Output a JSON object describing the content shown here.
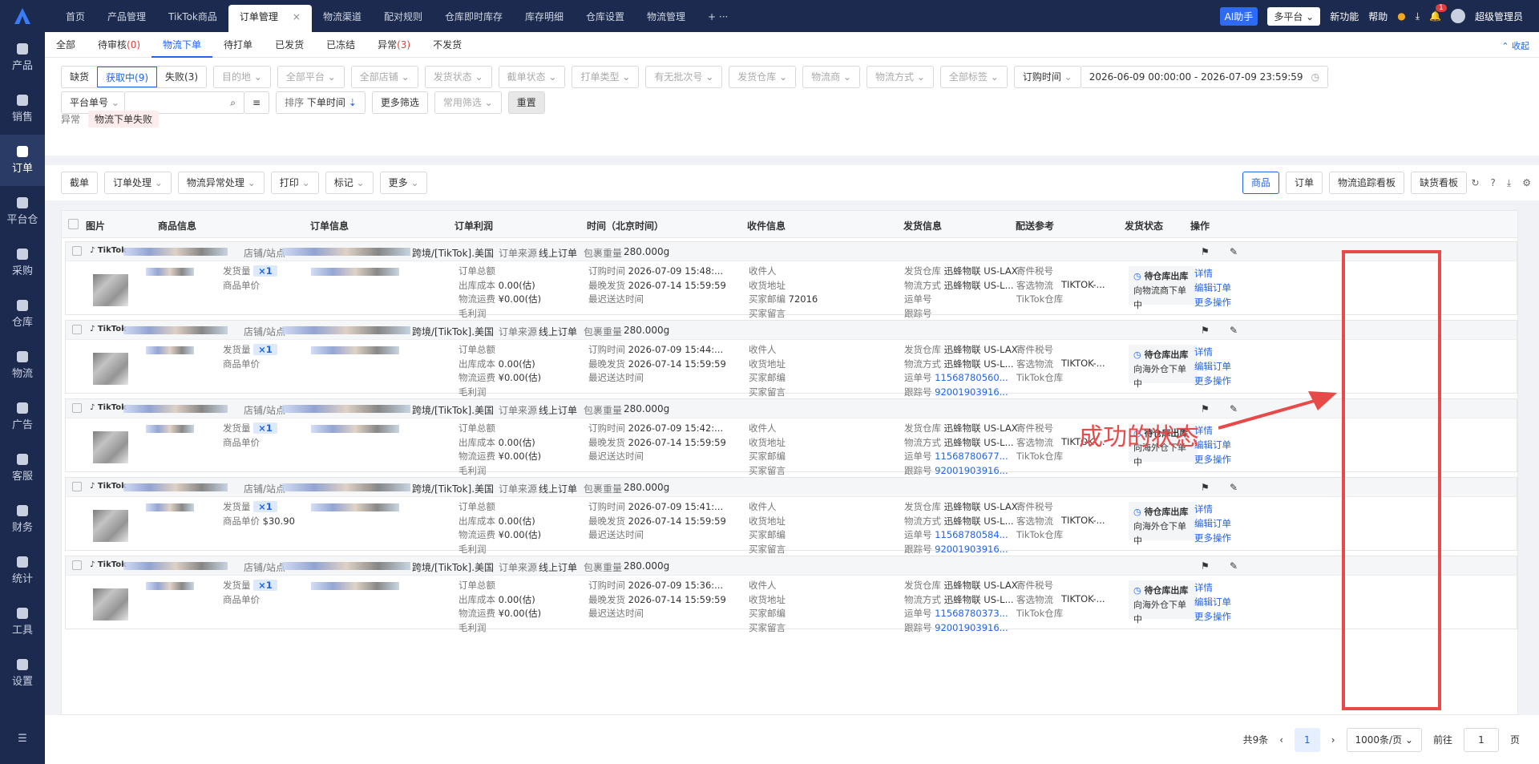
{
  "topbar": {
    "tabs": [
      "首页",
      "产品管理",
      "TikTok商品",
      "订单管理",
      "物流渠道",
      "配对规则",
      "仓库即时库存",
      "库存明细",
      "仓库设置",
      "物流管理"
    ],
    "active_tab": "订单管理",
    "ai_label": "AI助手",
    "platform_label": "多平台",
    "new_feature": "新功能",
    "help": "帮助",
    "notify_count": "1",
    "user": "超级管理员"
  },
  "sidebar": [
    "产品",
    "销售",
    "订单",
    "平台仓",
    "采购",
    "仓库",
    "物流",
    "广告",
    "客服",
    "财务",
    "统计",
    "工具",
    "设置"
  ],
  "subnav": {
    "items": [
      {
        "label": "全部"
      },
      {
        "label": "待审核",
        "count": "(0)"
      },
      {
        "label": "物流下单"
      },
      {
        "label": "待打单"
      },
      {
        "label": "已发货"
      },
      {
        "label": "已冻结"
      },
      {
        "label": "异常",
        "count": "(3)"
      },
      {
        "label": "不发货"
      }
    ],
    "collapse": "收起"
  },
  "filters": {
    "seg": [
      "缺货",
      "获取中(9)",
      "失败(3)"
    ],
    "dropdowns": [
      "目的地",
      "全部平台",
      "全部店铺",
      "发货状态",
      "截单状态",
      "打单类型",
      "有无批次号",
      "发货仓库",
      "物流商",
      "物流方式",
      "全部标签"
    ],
    "date_type": "订购时间",
    "date_range": "2026-06-09 00:00:00  -  2026-07-09 23:59:59",
    "search_type": "平台单号",
    "sort_label": "排序",
    "sort_value": "下单时间",
    "more_filter": "更多筛选",
    "common_filter": "常用筛选",
    "reset": "重置",
    "exception_label": "异常",
    "exception_tag": "物流下单失败"
  },
  "toolbar": {
    "left": [
      "截单",
      "订单处理",
      "物流异常处理",
      "打印",
      "标记",
      "更多"
    ],
    "right": [
      "商品",
      "订单",
      "物流追踪看板",
      "缺货看板"
    ]
  },
  "table": {
    "headers": [
      "图片",
      "商品信息",
      "订单信息",
      "订单利润",
      "时间（北京时间）",
      "收件信息",
      "发货信息",
      "配送参考",
      "发货状态",
      "操作"
    ],
    "store_label": "店铺/站点",
    "site": "跨境/[TikTok].美国",
    "source_label": "订单来源",
    "source": "线上订单",
    "weight_label": "包裹重量",
    "weight": "280.000g",
    "product_labels": [
      "发货量",
      "商品单价"
    ],
    "profit_labels": [
      "订单总额",
      "出库成本",
      "物流运费",
      "毛利润"
    ],
    "time_labels": [
      "订购时间",
      "最晚发货",
      "最迟送达时间"
    ],
    "recv_labels": [
      "收件人",
      "收货地址",
      "买家邮编",
      "买家留言"
    ],
    "ship_labels": [
      "发货仓库",
      "物流方式",
      "运单号",
      "跟踪号"
    ],
    "ref_labels": [
      "寄件税号",
      "客选物流",
      "TikTok仓库"
    ],
    "status_main": "待仓库出库",
    "ops": [
      "详情",
      "编辑订单",
      "更多操作"
    ],
    "orders": [
      {
        "qty": "×1",
        "price": "",
        "cost": "0.00(估)",
        "freight": "¥0.00(估)",
        "order_time": "2026-07-09 15:48:...",
        "ship_time": "2026-07-14 15:59:59",
        "zip": "72016",
        "warehouse": "迅蜂物联 US-LAX",
        "method": "迅蜂物联 US-L...",
        "waybill": "",
        "track": "",
        "ref": "TIKTOK-...",
        "status_sub": "向物流商下单中"
      },
      {
        "qty": "×1",
        "price": "",
        "cost": "0.00(估)",
        "freight": "¥0.00(估)",
        "order_time": "2026-07-09 15:44:...",
        "ship_time": "2026-07-14 15:59:59",
        "zip": "",
        "warehouse": "迅蜂物联 US-LAX",
        "method": "迅蜂物联 US-L...",
        "waybill": "11568780560...",
        "track": "92001903916...",
        "ref": "TIKTOK-...",
        "status_sub": "向海外仓下单中"
      },
      {
        "qty": "×1",
        "price": "",
        "cost": "0.00(估)",
        "freight": "¥0.00(估)",
        "order_time": "2026-07-09 15:42:...",
        "ship_time": "2026-07-14 15:59:59",
        "zip": "",
        "warehouse": "迅蜂物联 US-LAX",
        "method": "迅蜂物联 US-L...",
        "waybill": "11568780677...",
        "track": "92001903916...",
        "ref": "TIKTOK-...",
        "status_sub": "向海外仓下单中"
      },
      {
        "qty": "×1",
        "price": "$30.90",
        "cost": "0.00(估)",
        "freight": "¥0.00(估)",
        "order_time": "2026-07-09 15:41:...",
        "ship_time": "2026-07-14 15:59:59",
        "zip": "",
        "warehouse": "迅蜂物联 US-LAX",
        "method": "迅蜂物联 US-L...",
        "waybill": "11568780584...",
        "track": "92001903916...",
        "ref": "TIKTOK-...",
        "status_sub": "向海外仓下单中"
      },
      {
        "qty": "×1",
        "price": "",
        "cost": "0.00(估)",
        "freight": "¥0.00(估)",
        "order_time": "2026-07-09 15:36:...",
        "ship_time": "2026-07-14 15:59:59",
        "zip": "",
        "warehouse": "迅蜂物联 US-LAX",
        "method": "迅蜂物联 US-L...",
        "waybill": "11568780373...",
        "track": "92001903916...",
        "ref": "TIKTOK-...",
        "status_sub": "向海外仓下单中"
      }
    ]
  },
  "annotation": "成功的状态",
  "pager": {
    "total": "共9条",
    "page": "1",
    "page_size": "1000条/页",
    "goto": "前往",
    "goto_value": "1",
    "page_unit": "页"
  },
  "colors": {
    "brand": "#1e63f2",
    "nav_bg": "#1b2a4e",
    "annotation": "#e84a4a"
  }
}
